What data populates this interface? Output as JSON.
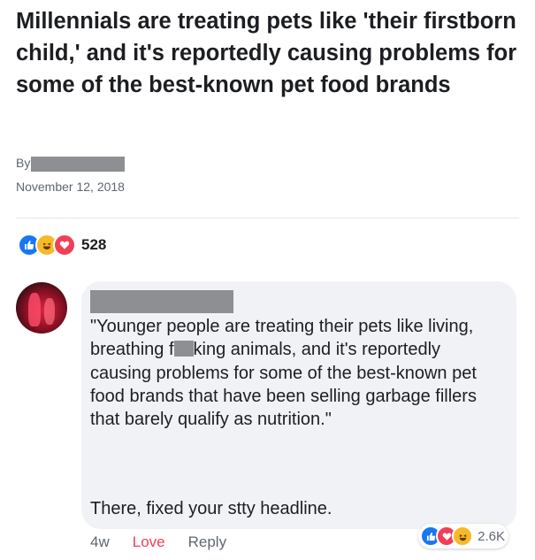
{
  "article": {
    "headline": "Millennials are treating pets like 'their firstborn child,' and it's reportedly causing problems for some of the best-known pet food brands",
    "by_label": "By",
    "date": "November 12, 2018"
  },
  "post_reactions": {
    "icons": [
      "like-icon",
      "haha-icon",
      "love-icon"
    ],
    "count": "528"
  },
  "comment": {
    "text_part1": "\"Younger people are treating their pets like living, breathing f",
    "text_part2": "king animals, and it's reportedly causing problems for some of the best-known pet food brands that have been selling garbage fillers that barely qualify as nutrition.\"",
    "fixed_part1": "There, fixed your s",
    "fixed_part2": "tty headline.",
    "time": "4w",
    "love_label": "Love",
    "reply_label": "Reply",
    "reactions": {
      "icons": [
        "like-icon",
        "love-icon",
        "haha-icon"
      ],
      "count": "2.6K"
    }
  },
  "colors": {
    "like": "#1877f2",
    "love": "#f33e58",
    "haha": "#f7b928",
    "bubble": "#f0f2f5",
    "redaction": "#8d8f93"
  }
}
